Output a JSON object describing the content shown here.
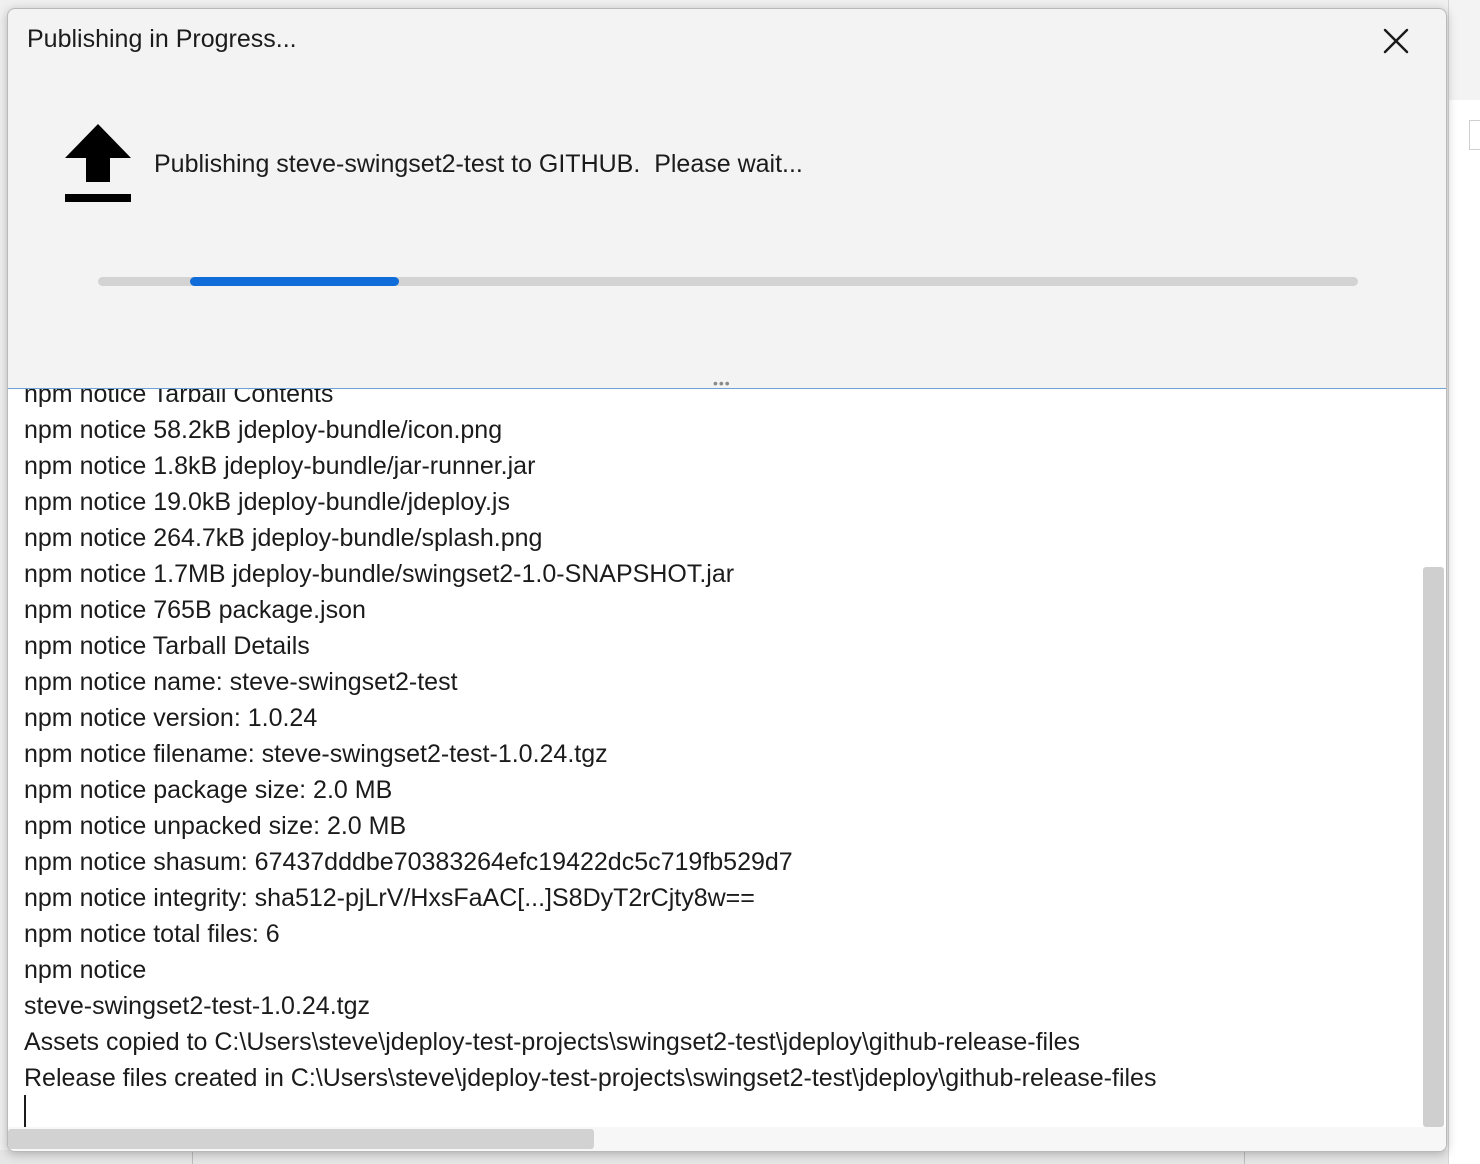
{
  "dialog": {
    "title": "Publishing in Progress...",
    "message": "Publishing steve-swingset2-test to GITHUB.  Please wait...",
    "progress_fraction": 0.166
  },
  "icons": {
    "close": "close-icon",
    "upload": "upload-arrow-icon"
  },
  "colors": {
    "progress_fill": "#0f6cd8",
    "progress_track": "#d3d3d3"
  },
  "log": {
    "lines": [
      "npm notice Tarball Contents",
      "npm notice 58.2kB jdeploy-bundle/icon.png",
      "npm notice 1.8kB jdeploy-bundle/jar-runner.jar",
      "npm notice 19.0kB jdeploy-bundle/jdeploy.js",
      "npm notice 264.7kB jdeploy-bundle/splash.png",
      "npm notice 1.7MB jdeploy-bundle/swingset2-1.0-SNAPSHOT.jar",
      "npm notice 765B package.json",
      "npm notice Tarball Details",
      "npm notice name: steve-swingset2-test",
      "npm notice version: 1.0.24",
      "npm notice filename: steve-swingset2-test-1.0.24.tgz",
      "npm notice package size: 2.0 MB",
      "npm notice unpacked size: 2.0 MB",
      "npm notice shasum: 67437dddbe70383264efc19422dc5c719fb529d7",
      "npm notice integrity: sha512-pjLrV/HxsFaAC[...]S8DyT2rCjty8w==",
      "npm notice total files: 6",
      "npm notice",
      "steve-swingset2-test-1.0.24.tgz",
      "Assets copied to C:\\Users\\steve\\jdeploy-test-projects\\swingset2-test\\jdeploy\\github-release-files",
      "Release files created in C:\\Users\\steve\\jdeploy-test-projects\\swingset2-test\\jdeploy\\github-release-files"
    ]
  }
}
